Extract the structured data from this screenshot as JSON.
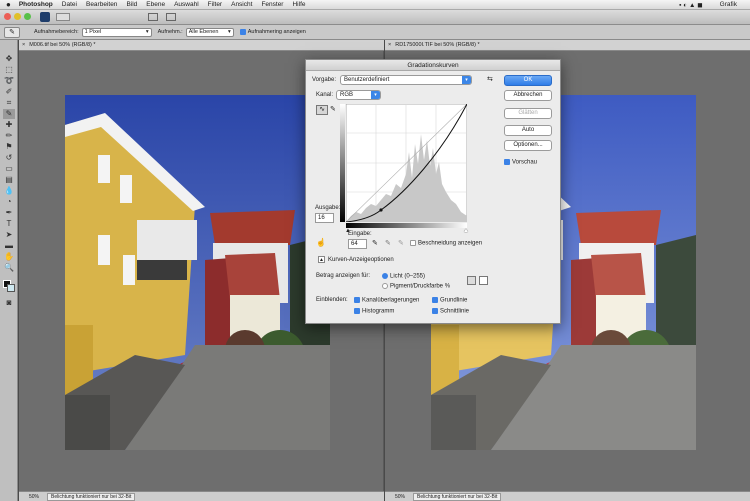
{
  "menubar": {
    "app": "Photoshop",
    "items": [
      "Datei",
      "Bearbeiten",
      "Bild",
      "Ebene",
      "Auswahl",
      "Filter",
      "Ansicht",
      "Fenster",
      "Hilfe"
    ],
    "right_label": "Grafik"
  },
  "options": {
    "sample_label": "Aufnahmebereich:",
    "sample_value": "1 Pixel",
    "layers_label": "Aufnehm.:",
    "layers_value": "Alle Ebenen",
    "ring_label": "Aufnahmering anzeigen"
  },
  "doc_left": {
    "tab": "M006.tif bei 50% (RGB/8) *",
    "zoom": "50%",
    "status": "Belichtung funktioniert nur bei 32-Bit"
  },
  "doc_right": {
    "tab": "RD175000I.TIF bei 50% (RGB/8) *",
    "zoom": "50%",
    "status": "Belichtung funktioniert nur bei 32-Bit"
  },
  "dialog": {
    "title": "Gradationskurven",
    "preset_label": "Vorgabe:",
    "preset_value": "Benutzerdefiniert",
    "channel_label": "Kanal:",
    "channel_value": "RGB",
    "output_label": "Ausgabe:",
    "output_value": "16",
    "input_label": "Eingabe:",
    "input_value": "64",
    "clipping_label": "Beschneidung anzeigen",
    "display_options_label": "Kurven-Anzeigeoptionen",
    "amount_label": "Betrag anzeigen für:",
    "light_label": "Licht (0–255)",
    "pigment_label": "Pigment/Druckfarbe %",
    "show_label": "Einblenden:",
    "overlay_label": "Kanalüberlagerungen",
    "baseline_label": "Grundlinie",
    "histogram_label": "Histogramm",
    "intersection_label": "Schnittlinie",
    "buttons": {
      "ok": "OK",
      "cancel": "Abbrechen",
      "smooth": "Glätten",
      "auto": "Auto",
      "options": "Optionen..."
    },
    "preview_label": "Vorschau"
  },
  "colors": {
    "accent": "#3b82e6",
    "sky": "#2f4aa3",
    "house_yellow": "#d8b44a",
    "roof_red": "#a33a2e"
  }
}
